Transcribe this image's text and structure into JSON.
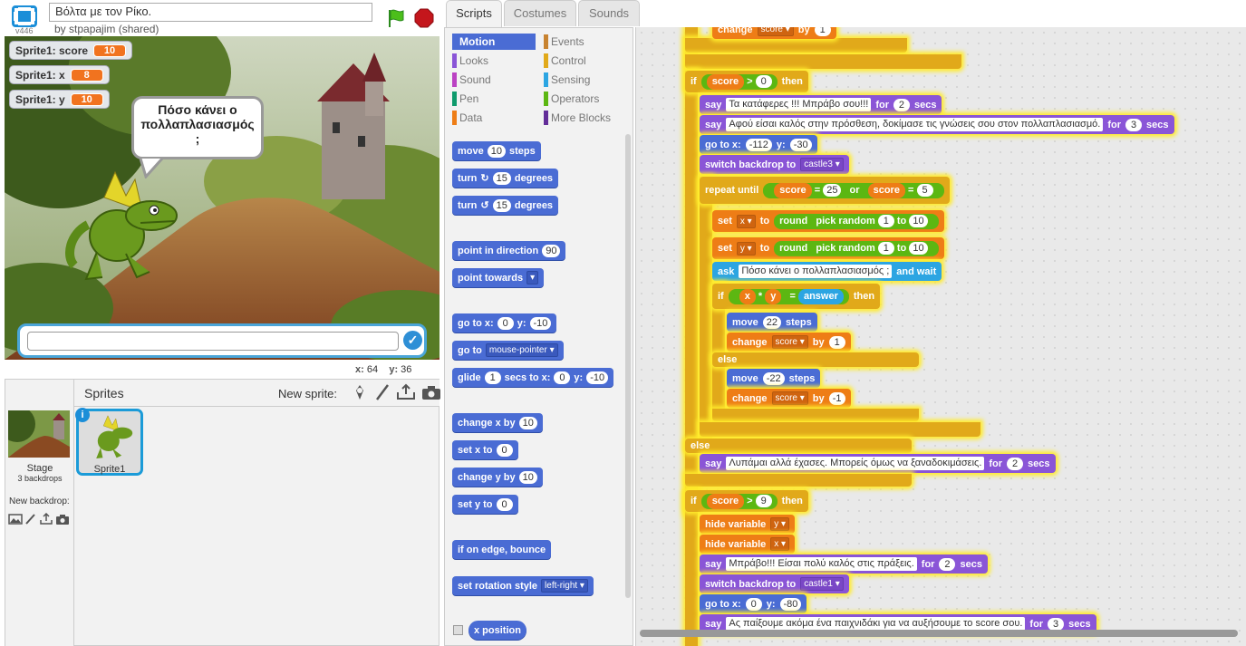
{
  "header": {
    "version": "v446",
    "project_title": "Βόλτα με τον Ρίκο.",
    "author": "by stpapajim (shared)"
  },
  "stage": {
    "watchers": [
      {
        "label": "Sprite1: score",
        "value": "10"
      },
      {
        "label": "Sprite1: x",
        "value": "8"
      },
      {
        "label": "Sprite1: y",
        "value": "10"
      }
    ],
    "bubble": "Πόσο κάνει ο πολλαπλασιασμός ;",
    "ask_input": ""
  },
  "coords": {
    "x_label": "x:",
    "x_value": "64",
    "y_label": "y:",
    "y_value": "36"
  },
  "sprites_pane": {
    "title": "Sprites",
    "new_sprite": "New sprite:",
    "stage_label": "Stage",
    "stage_backdrops": "3 backdrops",
    "new_backdrop": "New backdrop:",
    "sprite_name": "Sprite1"
  },
  "tabs": [
    "Scripts",
    "Costumes",
    "Sounds"
  ],
  "categories": [
    {
      "label": "Motion",
      "color": "#4a6cd4"
    },
    {
      "label": "Looks",
      "color": "#8a55d7"
    },
    {
      "label": "Sound",
      "color": "#bb42c3"
    },
    {
      "label": "Pen",
      "color": "#0e9a6c"
    },
    {
      "label": "Data",
      "color": "#ee7d16"
    },
    {
      "label": "Events",
      "color": "#c88330"
    },
    {
      "label": "Control",
      "color": "#e1a91a"
    },
    {
      "label": "Sensing",
      "color": "#2ca5e2"
    },
    {
      "label": "Operators",
      "color": "#5cb712"
    },
    {
      "label": "More Blocks",
      "color": "#632d99"
    }
  ],
  "palette": {
    "move": [
      "move",
      "10",
      "steps"
    ],
    "turn_cw": [
      "turn",
      "15",
      "degrees"
    ],
    "turn_ccw": [
      "turn",
      "15",
      "degrees"
    ],
    "point_dir": [
      "point in direction",
      "90"
    ],
    "point_towards": [
      "point towards",
      ""
    ],
    "goto_xy": [
      "go to x:",
      "0",
      "y:",
      "-10"
    ],
    "goto": [
      "go to",
      "mouse-pointer"
    ],
    "glide": [
      "glide",
      "1",
      "secs to x:",
      "0",
      "y:",
      "-10"
    ],
    "change_x": [
      "change x by",
      "10"
    ],
    "set_x": [
      "set x to",
      "0"
    ],
    "change_y": [
      "change y by",
      "10"
    ],
    "set_y": [
      "set y to",
      "0"
    ],
    "bounce": "if on edge, bounce",
    "rot_style": [
      "set rotation style",
      "left-right"
    ],
    "x_position": "x position"
  },
  "script": {
    "top_change": [
      "change",
      "score",
      "by",
      "1"
    ],
    "if1": [
      "if",
      "score",
      ">",
      "0",
      "then"
    ],
    "say1": [
      "say",
      "Τα κατάφερες !!! Μπράβο σου!!!",
      "for",
      "2",
      "secs"
    ],
    "say2": [
      "say",
      "Αφού είσαι καλός στην πρόσθεση, δοκίμασε τις γνώσεις σου στον πολλαπλασιασμό.",
      "for",
      "3",
      "secs"
    ],
    "goto1": [
      "go to x:",
      "-112",
      "y:",
      "-30"
    ],
    "backdrop1": [
      "switch backdrop to",
      "castle3"
    ],
    "repeat": [
      "repeat until",
      "score",
      "=",
      "25",
      "or",
      "score",
      "=",
      "5"
    ],
    "setx": [
      "set",
      "x",
      "to",
      "round",
      "pick random",
      "1",
      "to",
      "10"
    ],
    "sety": [
      "set",
      "y",
      "to",
      "round",
      "pick random",
      "1",
      "to",
      "10"
    ],
    "ask": [
      "ask",
      "Πόσο κάνει ο πολλαπλασιασμός ;",
      "and wait"
    ],
    "if2": [
      "if",
      "x",
      "*",
      "y",
      "=",
      "answer",
      "then"
    ],
    "move22": [
      "move",
      "22",
      "steps"
    ],
    "change_p": [
      "change",
      "score",
      "by",
      "1"
    ],
    "else": "else",
    "move_22": [
      "move",
      "-22",
      "steps"
    ],
    "change_n": [
      "change",
      "score",
      "by",
      "-1"
    ],
    "else2": "else",
    "say3": [
      "say",
      "Λυπάμαι αλλά έχασες. Μπορείς όμως να ξαναδοκιμάσεις.",
      "for",
      "2",
      "secs"
    ],
    "if3": [
      "if",
      "score",
      ">",
      "9",
      "then"
    ],
    "hide_y": [
      "hide variable",
      "y"
    ],
    "hide_x": [
      "hide variable",
      "x"
    ],
    "say4": [
      "say",
      "Μπράβο!!! Είσαι πολύ καλός στις πράξεις.",
      "for",
      "2",
      "secs"
    ],
    "backdrop2": [
      "switch backdrop to",
      "castle1"
    ],
    "goto2": [
      "go to x:",
      "0",
      "y:",
      "-80"
    ],
    "say5": [
      "say",
      "Ας παίξουμε ακόμα ένα παιχνιδάκι για να αυξήσουμε το score σου.",
      "for",
      "3",
      "secs"
    ]
  }
}
